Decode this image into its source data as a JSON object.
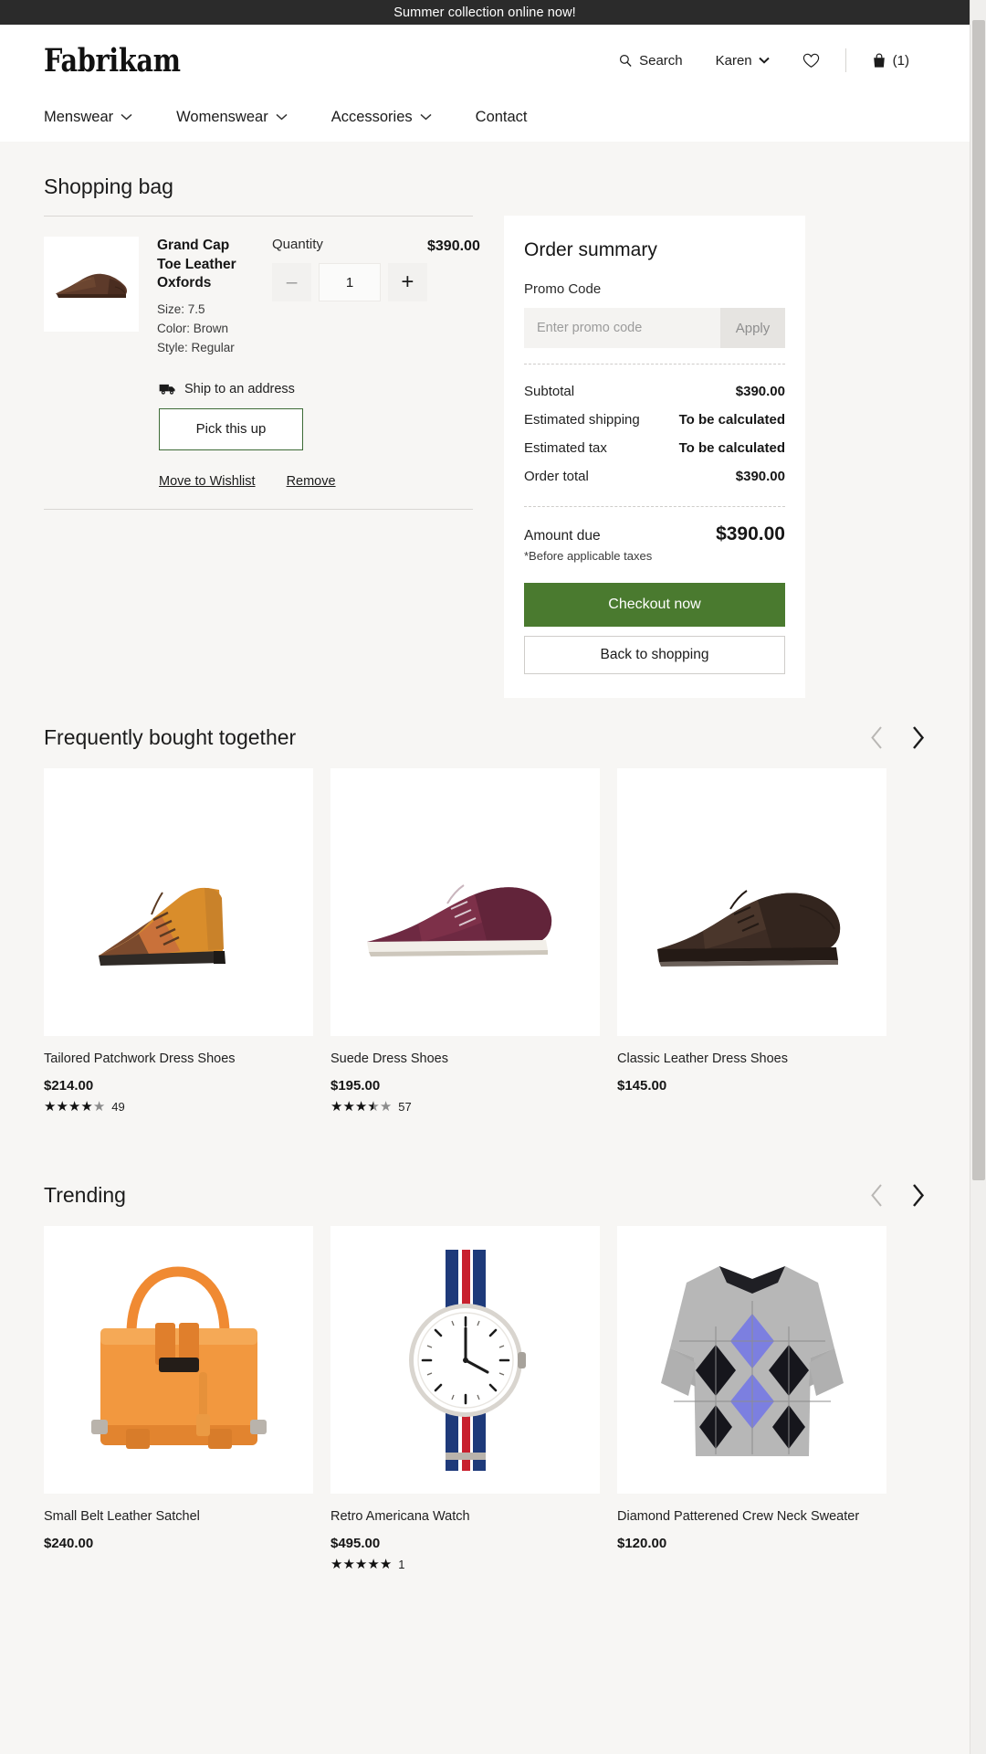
{
  "promo_bar": {
    "text": "Summer collection online now!"
  },
  "header": {
    "brand": "Fabrikam",
    "search_label": "Search",
    "account_label": "Karen",
    "wishlist_icon": "heart-icon",
    "bag_count": "(1)",
    "nav": [
      {
        "label": "Menswear",
        "has_chevron": true
      },
      {
        "label": "Womenswear",
        "has_chevron": true
      },
      {
        "label": "Accessories",
        "has_chevron": true
      },
      {
        "label": "Contact",
        "has_chevron": false
      }
    ]
  },
  "bag": {
    "title": "Shopping bag",
    "item": {
      "name": "Grand Cap Toe Leather Oxfords",
      "size_label": "Size:",
      "size_value": "7.5",
      "color_label": "Color:",
      "color_value": "Brown",
      "style_label": "Style:",
      "style_value": "Regular",
      "quantity_label": "Quantity",
      "quantity_value": "1",
      "decrement": "–",
      "increment": "+",
      "price": "$390.00",
      "ship_option": "Ship to an address",
      "pickup_button": "Pick this up",
      "move_to_wishlist": "Move to Wishlist",
      "remove": "Remove"
    }
  },
  "summary": {
    "title": "Order summary",
    "promo_label": "Promo Code",
    "promo_placeholder": "Enter promo code",
    "promo_value": "",
    "apply_label": "Apply",
    "rows": [
      {
        "label": "Subtotal",
        "value": "$390.00"
      },
      {
        "label": "Estimated shipping",
        "value": "To be calculated"
      },
      {
        "label": "Estimated tax",
        "value": "To be calculated"
      },
      {
        "label": "Order total",
        "value": "$390.00"
      }
    ],
    "amount_due_label": "Amount due",
    "amount_due_value": "$390.00",
    "before_taxes_note": "*Before applicable taxes",
    "checkout_label": "Checkout now",
    "back_label": "Back to shopping"
  },
  "fbt": {
    "title": "Frequently bought together",
    "prev_icon": "chevron-left-icon",
    "next_icon": "chevron-right-icon",
    "products": [
      {
        "name": "Tailored Patchwork Dress Shoes",
        "price": "$214.00",
        "rating": 4,
        "rating_count": "49",
        "has_rating": true
      },
      {
        "name": "Suede Dress Shoes",
        "price": "$195.00",
        "rating": 3.5,
        "rating_count": "57",
        "has_rating": true
      },
      {
        "name": "Classic Leather Dress Shoes",
        "price": "$145.00",
        "rating": 0,
        "rating_count": "",
        "has_rating": false
      }
    ]
  },
  "trending": {
    "title": "Trending",
    "prev_icon": "chevron-left-icon",
    "next_icon": "chevron-right-icon",
    "products": [
      {
        "name": "Small Belt Leather Satchel",
        "price": "$240.00",
        "rating": 0,
        "rating_count": "",
        "has_rating": false
      },
      {
        "name": "Retro Americana Watch",
        "price": "$495.00",
        "rating": 5,
        "rating_count": "1",
        "has_rating": true
      },
      {
        "name": "Diamond Patterened Crew Neck Sweater",
        "price": "$120.00",
        "rating": 0,
        "rating_count": "",
        "has_rating": false
      }
    ]
  },
  "colors": {
    "promo_bar_bg": "#2b2b2b",
    "checkout_green": "#4a7a2f",
    "pickup_border_green": "#3d6b36",
    "page_bg": "#f7f6f4"
  }
}
